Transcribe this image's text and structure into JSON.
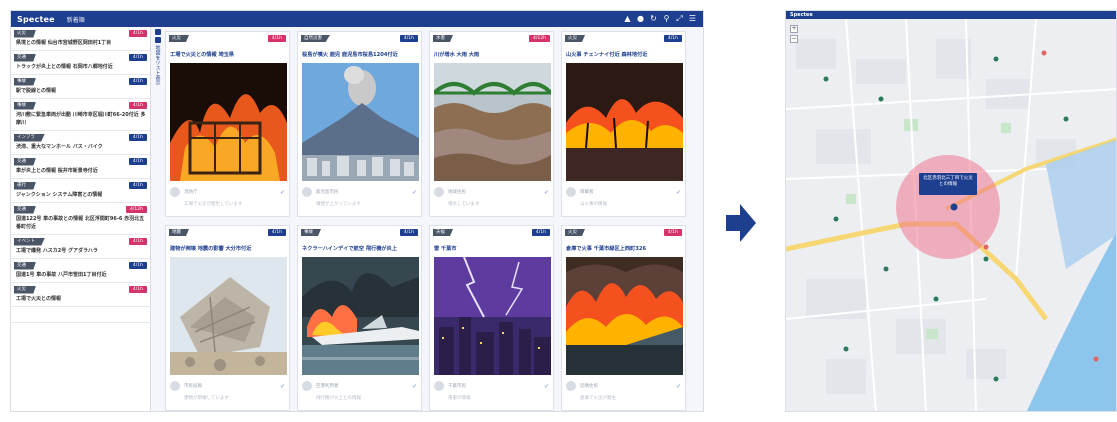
{
  "app": {
    "title": "Spectee",
    "subtitle": "新着順"
  },
  "topbar_icons": [
    "map-icon",
    "bell-icon",
    "refresh-icon",
    "search-icon",
    "expand-icon",
    "filter-icon"
  ],
  "sidebar": {
    "items": [
      {
        "tag": "火災",
        "badge": "4/1h",
        "badge_color": "#d6336c",
        "text": "県境との情報  仙台市宮城野区岡田村1丁目"
      },
      {
        "tag": "交通",
        "badge": "4/1h",
        "badge_color": "#1e3f8f",
        "text": "トラックが炎上との情報  石岡市八郷地付近"
      },
      {
        "tag": "事故",
        "badge": "4/1h",
        "badge_color": "#1e3f8f",
        "text": "駅で脱線との情報"
      },
      {
        "tag": "事故",
        "badge": "4/1h",
        "badge_color": "#d6336c",
        "text": "河川敷に緊急車両が出動  川崎市幸区堀川町66-20付近  多摩川"
      },
      {
        "tag": "インフラ",
        "badge": "4/1h",
        "badge_color": "#1e3f8f",
        "text": "渋滞、重大なマンホール  バス・バイク"
      },
      {
        "tag": "交通",
        "badge": "4/1h",
        "badge_color": "#1e3f8f",
        "text": "車が炎上との情報  桜井市新景寺付近"
      },
      {
        "tag": "運行",
        "badge": "4/1h",
        "badge_color": "#1e3f8f",
        "text": "ジャンクション  システム障害との情報"
      },
      {
        "tag": "交通",
        "badge": "4/12h",
        "badge_color": "#d6336c",
        "text": "国道122号  車の事故との情報  北区浮間町96-6  赤羽北五番町付近"
      },
      {
        "tag": "イベント",
        "badge": "4/1h",
        "badge_color": "#d6336c",
        "text": "工場で爆発  ハスカ2号  グアダラハラ"
      },
      {
        "tag": "交通",
        "badge": "4/1h",
        "badge_color": "#1e3f8f",
        "text": "国道1号  車の事故  八戸市笹田1丁目付近"
      },
      {
        "tag": "火災",
        "badge": "4/1h",
        "badge_color": "#d6336c",
        "text": "工場で火災との情報"
      },
      {
        "tag": "",
        "badge": "",
        "badge_color": "#1e3f8f",
        "text": ""
      }
    ]
  },
  "vertical_strip": {
    "label": "地図をリスト表示"
  },
  "cards": [
    {
      "tag": "火災",
      "badge": "4/1h",
      "badge_color": "#d6336c",
      "title": "工場で火災との情報  埼玉県",
      "image": "fire-building",
      "user": "消防庁",
      "meta": "工場で火災が発生しています"
    },
    {
      "tag": "自然災害",
      "badge": "4/1h",
      "badge_color": "#1e3f8f",
      "title": "桜島が噴火  鹿児  鹿児島市桜島1204付近",
      "image": "volcano",
      "user": "鹿児島市民",
      "meta": "噴煙が上がっています"
    },
    {
      "tag": "水害",
      "badge": "4/12h",
      "badge_color": "#d6336c",
      "title": "川が増水  大雨  大雨",
      "image": "flood",
      "user": "地域住民",
      "meta": "増水しています"
    },
    {
      "tag": "火災",
      "badge": "4/1h",
      "badge_color": "#1e3f8f",
      "title": "山火事  チェンナイ付近  森林地付近",
      "image": "wildfire",
      "user": "目撃者",
      "meta": "山火事の情報"
    },
    {
      "tag": "地震",
      "badge": "4/1h",
      "badge_color": "#1e3f8f",
      "title": "建物が倒壊  地震の影響  大分市付近",
      "image": "collapse",
      "user": "市民投稿",
      "meta": "建物が倒壊しています"
    },
    {
      "tag": "事故",
      "badge": "4/1h",
      "badge_color": "#1e3f8f",
      "title": "ネクラーハインデイで航空  飛行機が炎上",
      "image": "plane-fire",
      "user": "空港利用者",
      "meta": "飛行機が炎上との情報"
    },
    {
      "tag": "天候",
      "badge": "4/1h",
      "badge_color": "#1e3f8f",
      "title": "雷  千葉市",
      "image": "lightning",
      "user": "千葉市民",
      "meta": "落雷の情報"
    },
    {
      "tag": "火災",
      "badge": "4/1h",
      "badge_color": "#d6336c",
      "title": "倉庫で火事  千葉市緑区上西町326",
      "image": "warehouse-fire",
      "user": "近隣住民",
      "meta": "倉庫で火災が発生"
    }
  ],
  "arrow": {
    "icon": "right-arrow-icon",
    "color": "#1e3f8f"
  },
  "map": {
    "title": "Spectee",
    "popup_text": "北区赤羽北三丁目で火災との情報",
    "zoom_in": "+",
    "zoom_out": "−",
    "highlight_color": "#f06b8a"
  }
}
